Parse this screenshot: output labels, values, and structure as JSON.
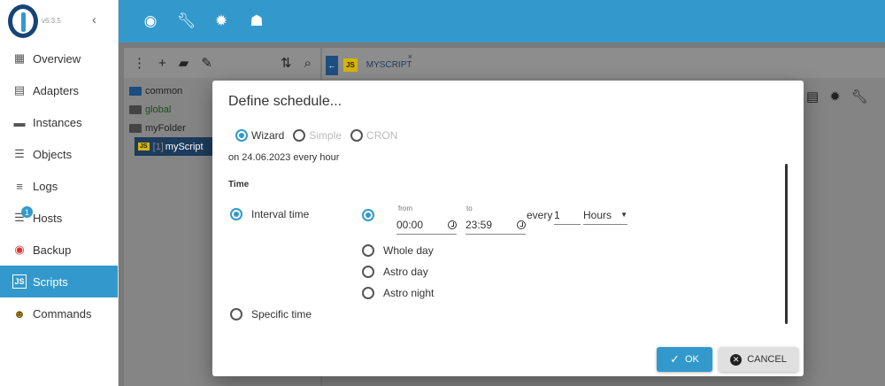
{
  "app": {
    "version": "v6.3.5"
  },
  "sidebar": {
    "collapse_icon": "chevron-left-icon",
    "items": [
      {
        "label": "Overview",
        "icon": "grid-icon"
      },
      {
        "label": "Adapters",
        "icon": "store-icon"
      },
      {
        "label": "Instances",
        "icon": "instances-icon"
      },
      {
        "label": "Objects",
        "icon": "list-icon"
      },
      {
        "label": "Logs",
        "icon": "lines-icon"
      },
      {
        "label": "Hosts",
        "icon": "hosts-icon",
        "badge": "1"
      },
      {
        "label": "Backup",
        "icon": "backup-icon"
      },
      {
        "label": "Scripts",
        "icon": "js-icon",
        "active": true
      },
      {
        "label": "Commands",
        "icon": "person-icon"
      }
    ]
  },
  "topbar": {
    "icons": [
      "eye-icon",
      "wrench-icon",
      "bug-icon",
      "brain-icon"
    ]
  },
  "tree": {
    "items": [
      {
        "label": "common",
        "type": "folder"
      },
      {
        "label": "global",
        "type": "folder-open"
      },
      {
        "label": "myFolder",
        "type": "folder-open"
      },
      {
        "label": "myScript",
        "type": "script",
        "prefix": "[1]"
      }
    ]
  },
  "editor": {
    "tab_label": "MYSCRIPT",
    "tab_close": "×"
  },
  "dialog": {
    "title": "Define schedule...",
    "modes": [
      {
        "label": "Wizard",
        "selected": true
      },
      {
        "label": "Simple",
        "selected": false
      },
      {
        "label": "CRON",
        "selected": false
      }
    ],
    "summary": "on 24.06.2023 every hour",
    "section": "Time",
    "interval_label": "Interval time",
    "specific_label": "Specific time",
    "from_label": "from",
    "to_label": "to",
    "from_value": "00:00",
    "to_value": "23:59",
    "every_label": "every",
    "every_value": "1",
    "unit": "Hours",
    "day_options": [
      "Whole day",
      "Astro day",
      "Astro night"
    ],
    "ok_label": "OK",
    "cancel_label": "CANCEL"
  },
  "colors": {
    "accent": "#3399cc",
    "dark_blue": "#164477"
  }
}
